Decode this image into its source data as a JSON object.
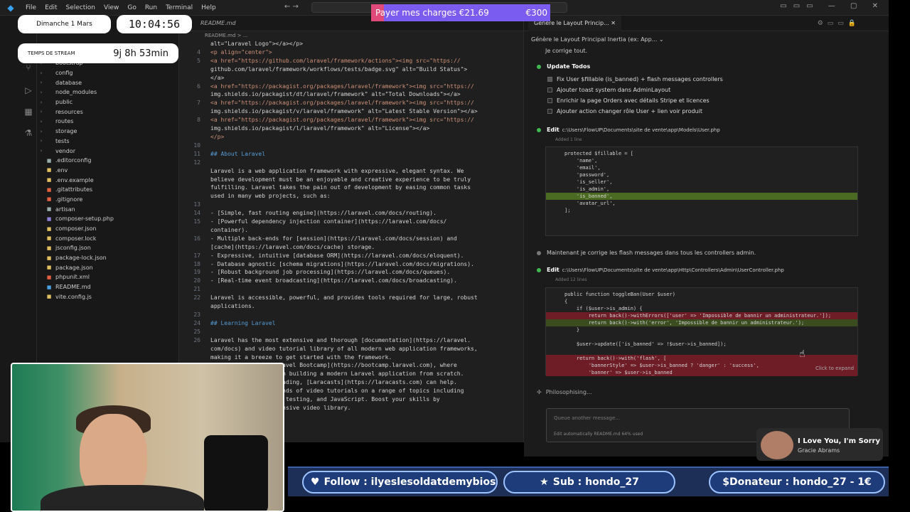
{
  "titlebar": {
    "menu": [
      "File",
      "Edit",
      "Selection",
      "View",
      "Go",
      "Run",
      "Terminal",
      "Help"
    ]
  },
  "overlay": {
    "date": "Dimanche 1 Mars",
    "clock": "10:04:56",
    "stream_label": "TEMPS DE STREAM",
    "stream_time": "9j 8h 53min",
    "donation_text": "Payer mes charges €21.69",
    "donation_goal": "€300",
    "donation_progress": 0.072,
    "follow": "Follow : ilyeslesoldatdemybios",
    "sub": "Sub : hondo_27",
    "donor": "$Donateur : hondo_27 - 1€",
    "music_song": "I Love You, I'm Sorry",
    "music_artist": "Gracie Abrams"
  },
  "explorer": {
    "items": [
      {
        "name": "bootstrap",
        "type": "folder",
        "color": "#9aa"
      },
      {
        "name": "config",
        "type": "folder",
        "color": "#9aa"
      },
      {
        "name": "database",
        "type": "folder",
        "color": "#9aa"
      },
      {
        "name": "node_modules",
        "type": "folder",
        "color": "#9aa"
      },
      {
        "name": "public",
        "type": "folder",
        "color": "#9aa"
      },
      {
        "name": "resources",
        "type": "folder",
        "color": "#9aa"
      },
      {
        "name": "routes",
        "type": "folder",
        "color": "#9aa"
      },
      {
        "name": "storage",
        "type": "folder",
        "color": "#9aa"
      },
      {
        "name": "tests",
        "type": "folder",
        "color": "#9aa"
      },
      {
        "name": "vendor",
        "type": "folder",
        "color": "#9aa"
      },
      {
        "name": ".editorconfig",
        "type": "file",
        "color": "#9aa"
      },
      {
        "name": ".env",
        "type": "file",
        "color": "#e0c060"
      },
      {
        "name": ".env.example",
        "type": "file",
        "color": "#e0c060"
      },
      {
        "name": ".gitattributes",
        "type": "file",
        "color": "#e06040"
      },
      {
        "name": ".gitignore",
        "type": "file",
        "color": "#e06040"
      },
      {
        "name": "artisan",
        "type": "file",
        "color": "#9aa"
      },
      {
        "name": "composer-setup.php",
        "type": "file",
        "color": "#8c7fd6"
      },
      {
        "name": "composer.json",
        "type": "file",
        "color": "#e0c060"
      },
      {
        "name": "composer.lock",
        "type": "file",
        "color": "#e0c060"
      },
      {
        "name": "jsconfig.json",
        "type": "file",
        "color": "#e0c060"
      },
      {
        "name": "package-lock.json",
        "type": "file",
        "color": "#e0c060"
      },
      {
        "name": "package.json",
        "type": "file",
        "color": "#e0c060"
      },
      {
        "name": "phpunit.xml",
        "type": "file",
        "color": "#e06040"
      },
      {
        "name": "README.md",
        "type": "file",
        "color": "#4aa0e0"
      },
      {
        "name": "vite.config.js",
        "type": "file",
        "color": "#e0c060"
      }
    ]
  },
  "editor": {
    "tab": "README.md",
    "breadcrumb": "README.md > ...",
    "lines": [
      {
        "n": "",
        "t": "alt=\"Laravel Logo\"></a></p>"
      },
      {
        "n": "",
        "t": ""
      },
      {
        "n": "4",
        "t": "<p align=\"center\">"
      },
      {
        "n": "5",
        "t": "<a href=\"https://github.com/laravel/framework/actions\"><img src=\"https://"
      },
      {
        "n": "",
        "t": "github.com/laravel/framework/workflows/tests/badge.svg\" alt=\"Build Status\"></a>"
      },
      {
        "n": "6",
        "t": "<a href=\"https://packagist.org/packages/laravel/framework\"><img src=\"https://"
      },
      {
        "n": "",
        "t": "img.shields.io/packagist/dt/laravel/framework\" alt=\"Total Downloads\"></a>"
      },
      {
        "n": "7",
        "t": "<a href=\"https://packagist.org/packages/laravel/framework\"><img src=\"https://"
      },
      {
        "n": "",
        "t": "img.shields.io/packagist/v/laravel/framework\" alt=\"Latest Stable Version\"></a>"
      },
      {
        "n": "8",
        "t": "<a href=\"https://packagist.org/packages/laravel/framework\"><img src=\"https://"
      },
      {
        "n": "",
        "t": "img.shields.io/packagist/l/laravel/framework\" alt=\"License\"></a>"
      },
      {
        "n": "",
        "t": "</p>"
      },
      {
        "n": "10",
        "t": ""
      },
      {
        "n": "11",
        "t": "## About Laravel"
      },
      {
        "n": "12",
        "t": ""
      },
      {
        "n": "",
        "t": "Laravel is a web application framework with expressive, elegant syntax. We"
      },
      {
        "n": "",
        "t": "believe development must be an enjoyable and creative experience to be truly"
      },
      {
        "n": "",
        "t": "fulfilling. Laravel takes the pain out of development by easing common tasks"
      },
      {
        "n": "",
        "t": "used in many web projects, such as:"
      },
      {
        "n": "",
        "t": ""
      },
      {
        "n": "13",
        "t": ""
      },
      {
        "n": "14",
        "t": "- [Simple, fast routing engine](https://laravel.com/docs/routing)."
      },
      {
        "n": "15",
        "t": "- [Powerful dependency injection container](https://laravel.com/docs/"
      },
      {
        "n": "",
        "t": "container)."
      },
      {
        "n": "16",
        "t": "- Multiple back-ends for [session](https://laravel.com/docs/session) and"
      },
      {
        "n": "",
        "t": "[cache](https://laravel.com/docs/cache) storage."
      },
      {
        "n": "17",
        "t": "- Expressive, intuitive [database ORM](https://laravel.com/docs/eloquent)."
      },
      {
        "n": "18",
        "t": "- Database agnostic [schema migrations](https://laravel.com/docs/migrations)."
      },
      {
        "n": "19",
        "t": "- [Robust background job processing](https://laravel.com/docs/queues)."
      },
      {
        "n": "20",
        "t": "- [Real-time event broadcasting](https://laravel.com/docs/broadcasting)."
      },
      {
        "n": "21",
        "t": ""
      },
      {
        "n": "22",
        "t": "Laravel is accessible, powerful, and provides tools required for large, robust"
      },
      {
        "n": "",
        "t": "applications."
      },
      {
        "n": "23",
        "t": ""
      },
      {
        "n": "24",
        "t": "## Learning Laravel"
      },
      {
        "n": "25",
        "t": ""
      },
      {
        "n": "26",
        "t": "Laravel has the most extensive and thorough [documentation](https://laravel."
      },
      {
        "n": "",
        "t": "com/docs) and video tutorial library of all modern web application frameworks,"
      },
      {
        "n": "",
        "t": "making it a breeze to get started with the framework."
      },
      {
        "n": "",
        "t": ""
      },
      {
        "n": "",
        "t": "                    ravel Bootcamp](https://bootcamp.laravel.com), where"
      },
      {
        "n": "",
        "t": "                    gh building a modern Laravel application from scratch."
      },
      {
        "n": "",
        "t": ""
      },
      {
        "n": "",
        "t": "                    eading, [Laracasts](https://laracasts.com) can help."
      },
      {
        "n": "",
        "t": "                    ands of video tutorials on a range of topics including"
      },
      {
        "n": "",
        "t": "                    t testing, and JavaScript. Boost your skills by"
      },
      {
        "n": "",
        "t": "                    ensive video library."
      }
    ]
  },
  "chat": {
    "tab_title": "Génère le Layout Princip...",
    "subtitle": "Génère le Layout Principal Inertia (ex: App...",
    "intro": "Je corrige tout.",
    "todos_title": "Update Todos",
    "todos": [
      {
        "label": "Fix User $fillable (is_banned) + flash messages controllers",
        "done": true
      },
      {
        "label": "Ajouter toast system dans AdminLayout",
        "done": false
      },
      {
        "label": "Enrichir la page Orders avec détails Stripe et licences",
        "done": false
      },
      {
        "label": "Ajouter action changer rôle User + lien voir produit",
        "done": false
      }
    ],
    "edit1_label": "Edit",
    "edit1_path": "c:\\Users\\FlowUP\\Documents\\site de vente\\app\\Models\\User.php",
    "edit1_sub": "Added 1 line",
    "edit1_code": [
      {
        "t": "protected $fillable = [",
        "k": ""
      },
      {
        "t": "    'name',",
        "k": ""
      },
      {
        "t": "    'email',",
        "k": ""
      },
      {
        "t": "    'password',",
        "k": ""
      },
      {
        "t": "    'is_seller',",
        "k": ""
      },
      {
        "t": "    'is_admin',",
        "k": ""
      },
      {
        "t": "    'is_banned',",
        "k": "add"
      },
      {
        "t": "    'avatar_url',",
        "k": ""
      },
      {
        "t": "];",
        "k": ""
      }
    ],
    "middle_text": "Maintenant je corrige les flash messages dans tous les controllers admin.",
    "edit2_label": "Edit",
    "edit2_path": "c:\\Users\\FlowUP\\Documents\\site de vente\\app\\Http\\Controllers\\Admin\\UserController.php",
    "edit2_sub": "Added 12 lines",
    "edit2_code": [
      {
        "t": "public function toggleBan(User $user)",
        "k": ""
      },
      {
        "t": "{",
        "k": ""
      },
      {
        "t": "    if ($user->is_admin) {",
        "k": ""
      },
      {
        "t": "        return back()->withErrors(['user' => 'Impossible de bannir un administrateur.']);",
        "k": "del"
      },
      {
        "t": "        return back()->with('error', 'Impossible de bannir un administrateur.');",
        "k": "add2"
      },
      {
        "t": "    }",
        "k": ""
      },
      {
        "t": "",
        "k": ""
      },
      {
        "t": "    $user->update(['is_banned' => !$user->is_banned]);",
        "k": ""
      },
      {
        "t": "",
        "k": ""
      },
      {
        "t": "    return back()->with('flash', [",
        "k": "del"
      },
      {
        "t": "        'bannerStyle' => $user->is_banned ? 'danger' : 'success',",
        "k": "del"
      },
      {
        "t": "        'banner' => $user->is_banned",
        "k": "del"
      }
    ],
    "click_expand": "Click to expand",
    "philosophising": "Philosophising...",
    "input_placeholder": "Queue another message...",
    "input_footer": "Edit automatically   README.md   64% used"
  },
  "colors": {
    "accent": "#3aa0f0",
    "success": "#3fb950",
    "donation_fill": "#e04a7a",
    "donation_bg": "#7b5cf0"
  }
}
